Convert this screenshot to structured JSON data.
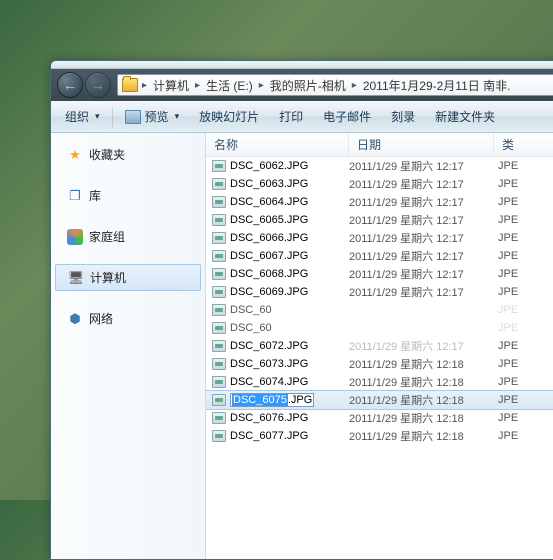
{
  "breadcrumb": {
    "items": [
      "计算机",
      "生活 (E:)",
      "我的照片-相机",
      "2011年1月29-2月11日 南非."
    ]
  },
  "toolbar": {
    "organize": "组织",
    "preview": "预览",
    "slideshow": "放映幻灯片",
    "print": "打印",
    "email": "电子邮件",
    "burn": "刻录",
    "newfolder": "新建文件夹"
  },
  "sidebar": {
    "favorites": "收藏夹",
    "libraries": "库",
    "homegroup": "家庭组",
    "computer": "计算机",
    "network": "网络"
  },
  "columns": {
    "name": "名称",
    "date": "日期",
    "type": "类"
  },
  "file_rows": [
    {
      "name": "DSC_6062.JPG",
      "date": "2011/1/29 星期六 12:17",
      "type": "JPE"
    },
    {
      "name": "DSC_6063.JPG",
      "date": "2011/1/29 星期六 12:17",
      "type": "JPE"
    },
    {
      "name": "DSC_6064.JPG",
      "date": "2011/1/29 星期六 12:17",
      "type": "JPE"
    },
    {
      "name": "DSC_6065.JPG",
      "date": "2011/1/29 星期六 12:17",
      "type": "JPE"
    },
    {
      "name": "DSC_6066.JPG",
      "date": "2011/1/29 星期六 12:17",
      "type": "JPE"
    },
    {
      "name": "DSC_6067.JPG",
      "date": "2011/1/29 星期六 12:17",
      "type": "JPE"
    },
    {
      "name": "DSC_6068.JPG",
      "date": "2011/1/29 星期六 12:17",
      "type": "JPE"
    },
    {
      "name": "DSC_6069.JPG",
      "date": "2011/1/29 星期六 12:17",
      "type": "JPE"
    },
    {
      "name": "DSC_60",
      "date": "",
      "type": "JPE",
      "obs": true
    },
    {
      "name": "DSC_60",
      "date": "",
      "type": "JPE",
      "obs": true
    },
    {
      "name": "DSC_6072.JPG",
      "date": "2011/1/29 星期六 12:17",
      "type": "JPE",
      "partial": true
    },
    {
      "name": "DSC_6073.JPG",
      "date": "2011/1/29 星期六 12:18",
      "type": "JPE"
    },
    {
      "name": "DSC_6074.JPG",
      "date": "2011/1/29 星期六 12:18",
      "type": "JPE"
    },
    {
      "name": "DSC_6075.JPG",
      "date": "2011/1/29 星期六 12:18",
      "type": "JPE",
      "renaming": true,
      "sel": "DSC_6075",
      "rest": ".JPG"
    },
    {
      "name": "DSC_6076.JPG",
      "date": "2011/1/29 星期六 12:18",
      "type": "JPE"
    },
    {
      "name": "DSC_6077.JPG",
      "date": "2011/1/29 星期六 12:18",
      "type": "JPE"
    }
  ]
}
